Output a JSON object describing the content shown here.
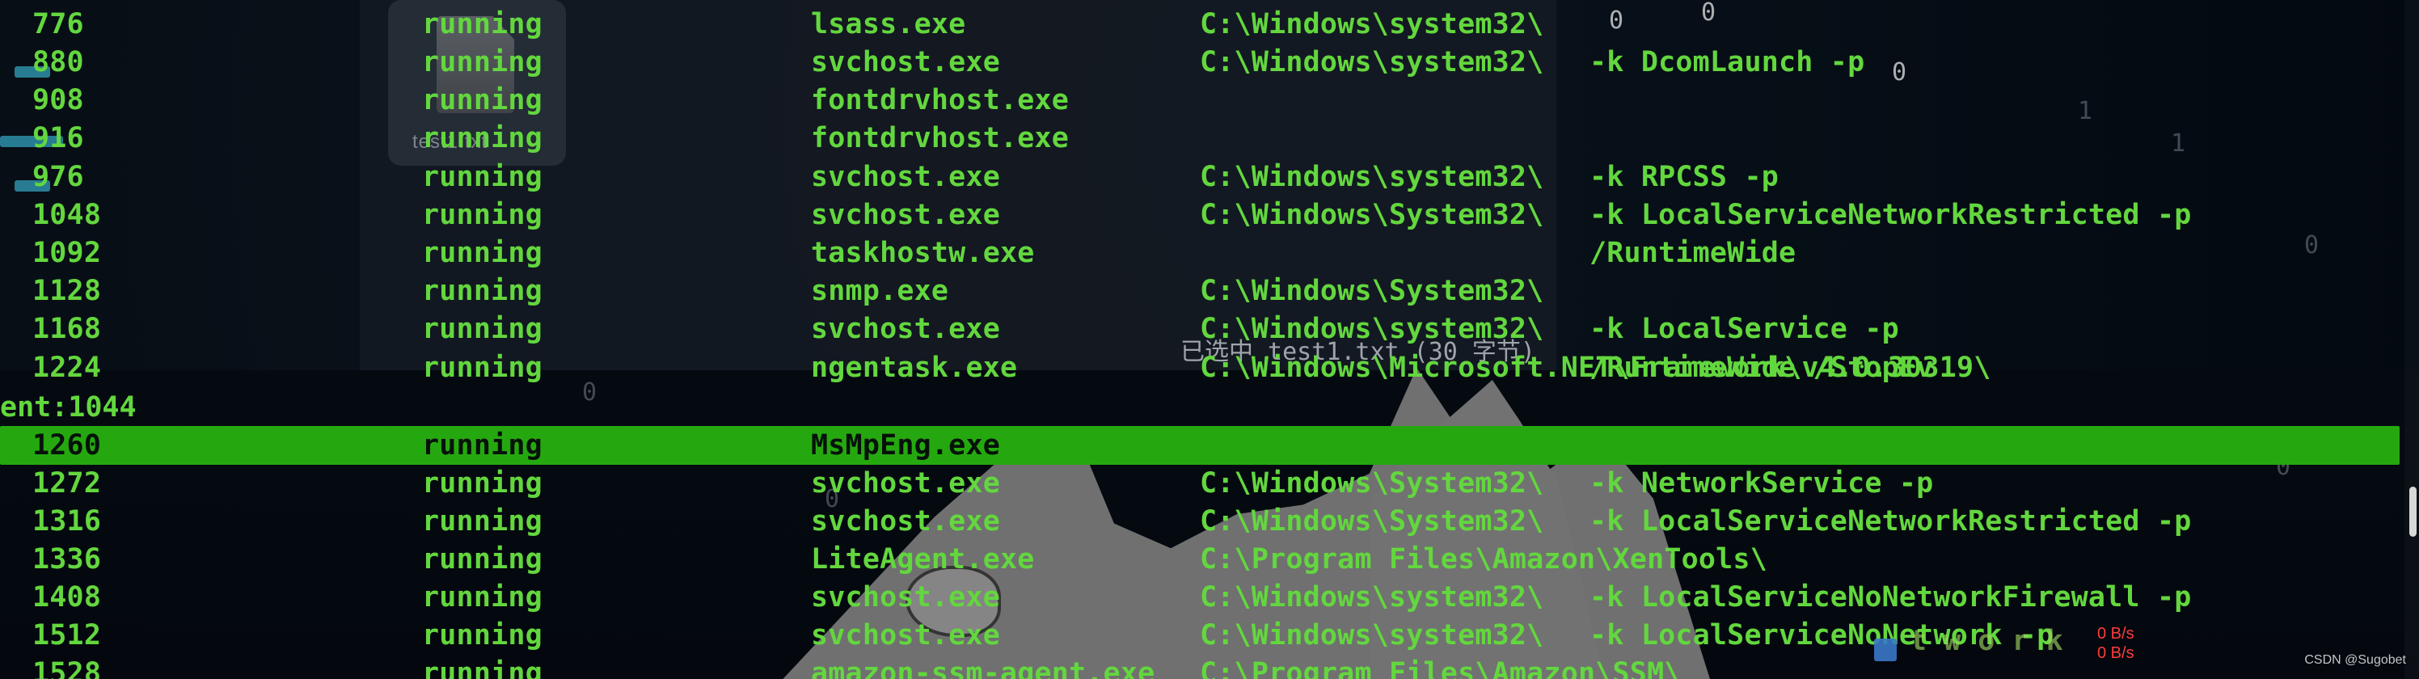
{
  "terminal": {
    "rows_top": [
      {
        "pid": "776",
        "status": "running",
        "name": "lsass.exe",
        "path": "C:\\Windows\\system32\\",
        "args": ""
      },
      {
        "pid": "880",
        "status": "running",
        "name": "svchost.exe",
        "path": "C:\\Windows\\system32\\",
        "args": "-k DcomLaunch -p"
      },
      {
        "pid": "908",
        "status": "running",
        "name": "fontdrvhost.exe",
        "path": "",
        "args": ""
      },
      {
        "pid": "916",
        "status": "running",
        "name": "fontdrvhost.exe",
        "path": "",
        "args": ""
      },
      {
        "pid": "976",
        "status": "running",
        "name": "svchost.exe",
        "path": "C:\\Windows\\system32\\",
        "args": "-k RPCSS -p"
      },
      {
        "pid": "1048",
        "status": "running",
        "name": "svchost.exe",
        "path": "C:\\Windows\\System32\\",
        "args": "-k LocalServiceNetworkRestricted -p"
      },
      {
        "pid": "1092",
        "status": "running",
        "name": "taskhostw.exe",
        "path": "",
        "args": "/RuntimeWide"
      },
      {
        "pid": "1128",
        "status": "running",
        "name": "snmp.exe",
        "path": "C:\\Windows\\System32\\",
        "args": ""
      },
      {
        "pid": "1168",
        "status": "running",
        "name": "svchost.exe",
        "path": "C:\\Windows\\system32\\",
        "args": "-k LocalService -p"
      },
      {
        "pid": "1224",
        "status": "running",
        "name": "ngentask.exe",
        "path": "C:\\Windows\\Microsoft.NET\\Framework\\v4.0.30319\\",
        "args": "/RuntimeWide /StopEv"
      }
    ],
    "wrapped_line": "ent:1044",
    "highlight_row": {
      "pid": "1260",
      "status": "running",
      "name": "MsMpEng.exe",
      "path": "",
      "args": ""
    },
    "rows_bottom": [
      {
        "pid": "1272",
        "status": "running",
        "name": "svchost.exe",
        "path": "C:\\Windows\\System32\\",
        "args": "-k NetworkService -p"
      },
      {
        "pid": "1316",
        "status": "running",
        "name": "svchost.exe",
        "path": "C:\\Windows\\System32\\",
        "args": "-k LocalServiceNetworkRestricted -p"
      },
      {
        "pid": "1336",
        "status": "running",
        "name": "LiteAgent.exe",
        "path": "C:\\Program Files\\Amazon\\XenTools\\",
        "args": ""
      },
      {
        "pid": "1408",
        "status": "running",
        "name": "svchost.exe",
        "path": "C:\\Windows\\system32\\",
        "args": "-k LocalServiceNoNetworkFirewall -p"
      },
      {
        "pid": "1512",
        "status": "running",
        "name": "svchost.exe",
        "path": "C:\\Windows\\system32\\",
        "args": "-k LocalServiceNoNetwork -p"
      }
    ],
    "partial_row": {
      "pid": "1528",
      "status": "running",
      "name": "amazon-ssm-agent.exe",
      "path": "C:\\Program Files\\Amazon\\SSM\\",
      "args": ""
    }
  },
  "background": {
    "file_label": "test1.txt",
    "selection_text": "已选中 test1.txt (30 字节)"
  },
  "network": {
    "upload": "0 B/s",
    "download": "0 B/s"
  },
  "watermark": {
    "text": "CSDN @Sugobet"
  },
  "colors": {
    "terminal_text": "#63d73e",
    "highlight_bg": "#25a80f",
    "network_text": "#ff3b3b"
  }
}
